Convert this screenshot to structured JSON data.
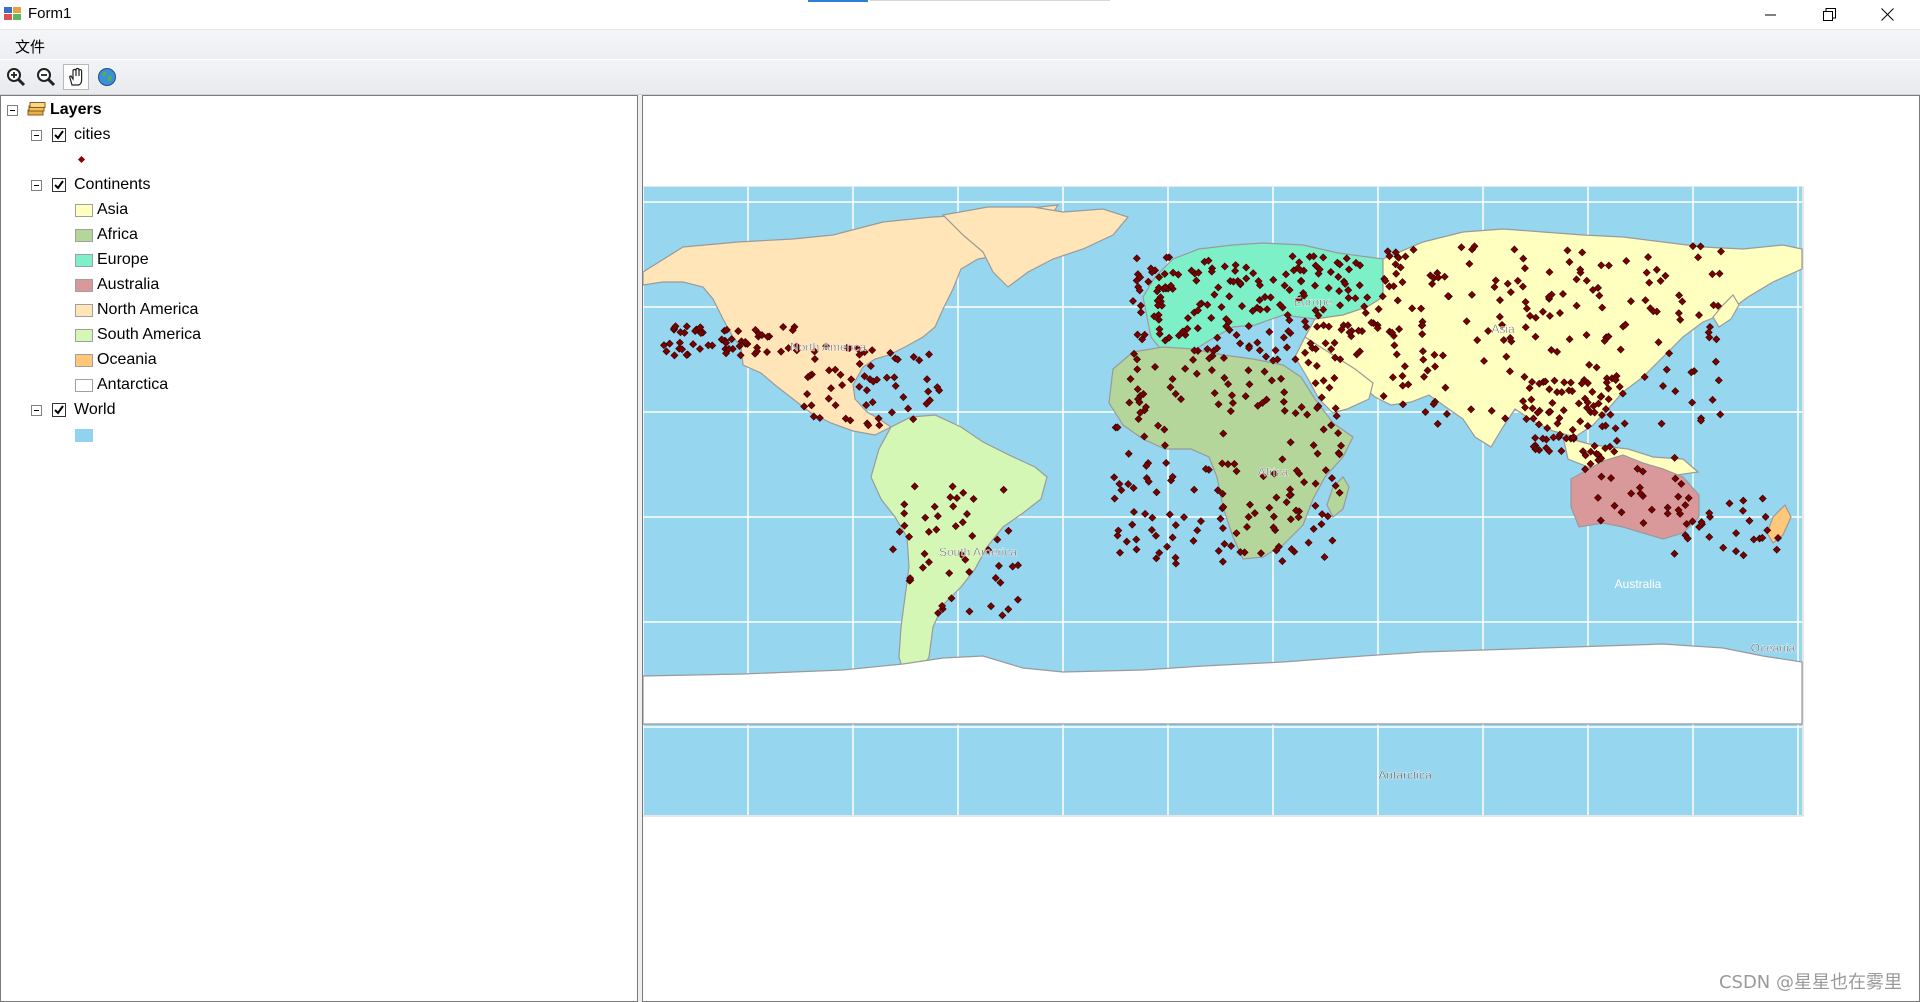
{
  "window": {
    "title": "Form1"
  },
  "menu": {
    "file_label": "文件"
  },
  "toolbar": {
    "tools": [
      "zoom-in-icon",
      "zoom-out-icon",
      "pan-hand-icon",
      "full-extent-globe-icon"
    ],
    "active_tool": "pan-hand-icon"
  },
  "toc": {
    "root_label": "Layers",
    "layers": [
      {
        "name": "cities",
        "checked": true,
        "symbol_color": "#8b0000"
      },
      {
        "name": "Continents",
        "checked": true,
        "classes": [
          {
            "label": "Asia",
            "color": "#ffffc0"
          },
          {
            "label": "Africa",
            "color": "#b5d69b"
          },
          {
            "label": "Europe",
            "color": "#7ef0c8"
          },
          {
            "label": "Australia",
            "color": "#d9999a"
          },
          {
            "label": "North America",
            "color": "#ffe5b8"
          },
          {
            "label": "South America",
            "color": "#d5f7b5"
          },
          {
            "label": "Oceania",
            "color": "#ffc77a"
          },
          {
            "label": "Antarctica",
            "color": "#ffffff"
          }
        ]
      },
      {
        "name": "World",
        "checked": true,
        "symbol_color": "#8fd3f0"
      }
    ]
  },
  "map": {
    "ocean_color": "#96d6ef",
    "grid_color": "#ffffff",
    "city_color": "#7a0000",
    "labels": [
      "North America",
      "Europe",
      "Asia",
      "Africa",
      "South America",
      "Australia",
      "Oceania",
      "Antarctica"
    ]
  },
  "watermark": "CSDN @星星也在雾里"
}
